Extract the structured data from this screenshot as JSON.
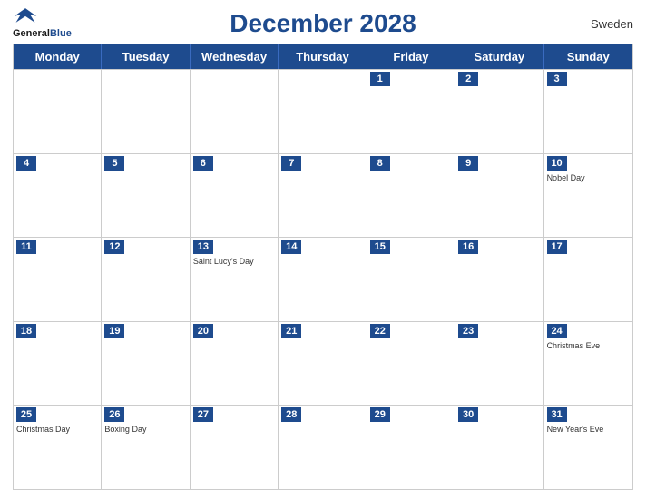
{
  "header": {
    "title": "December 2028",
    "country": "Sweden",
    "logo_general": "General",
    "logo_blue": "Blue"
  },
  "weekdays": [
    "Monday",
    "Tuesday",
    "Wednesday",
    "Thursday",
    "Friday",
    "Saturday",
    "Sunday"
  ],
  "weeks": [
    [
      {
        "day": "",
        "event": ""
      },
      {
        "day": "",
        "event": ""
      },
      {
        "day": "",
        "event": ""
      },
      {
        "day": "",
        "event": ""
      },
      {
        "day": "1",
        "event": ""
      },
      {
        "day": "2",
        "event": ""
      },
      {
        "day": "3",
        "event": ""
      }
    ],
    [
      {
        "day": "4",
        "event": ""
      },
      {
        "day": "5",
        "event": ""
      },
      {
        "day": "6",
        "event": ""
      },
      {
        "day": "7",
        "event": ""
      },
      {
        "day": "8",
        "event": ""
      },
      {
        "day": "9",
        "event": ""
      },
      {
        "day": "10",
        "event": "Nobel Day"
      }
    ],
    [
      {
        "day": "11",
        "event": ""
      },
      {
        "day": "12",
        "event": ""
      },
      {
        "day": "13",
        "event": "Saint Lucy's Day"
      },
      {
        "day": "14",
        "event": ""
      },
      {
        "day": "15",
        "event": ""
      },
      {
        "day": "16",
        "event": ""
      },
      {
        "day": "17",
        "event": ""
      }
    ],
    [
      {
        "day": "18",
        "event": ""
      },
      {
        "day": "19",
        "event": ""
      },
      {
        "day": "20",
        "event": ""
      },
      {
        "day": "21",
        "event": ""
      },
      {
        "day": "22",
        "event": ""
      },
      {
        "day": "23",
        "event": ""
      },
      {
        "day": "24",
        "event": "Christmas Eve"
      }
    ],
    [
      {
        "day": "25",
        "event": "Christmas Day"
      },
      {
        "day": "26",
        "event": "Boxing Day"
      },
      {
        "day": "27",
        "event": ""
      },
      {
        "day": "28",
        "event": ""
      },
      {
        "day": "29",
        "event": ""
      },
      {
        "day": "30",
        "event": ""
      },
      {
        "day": "31",
        "event": "New Year's Eve"
      }
    ]
  ]
}
